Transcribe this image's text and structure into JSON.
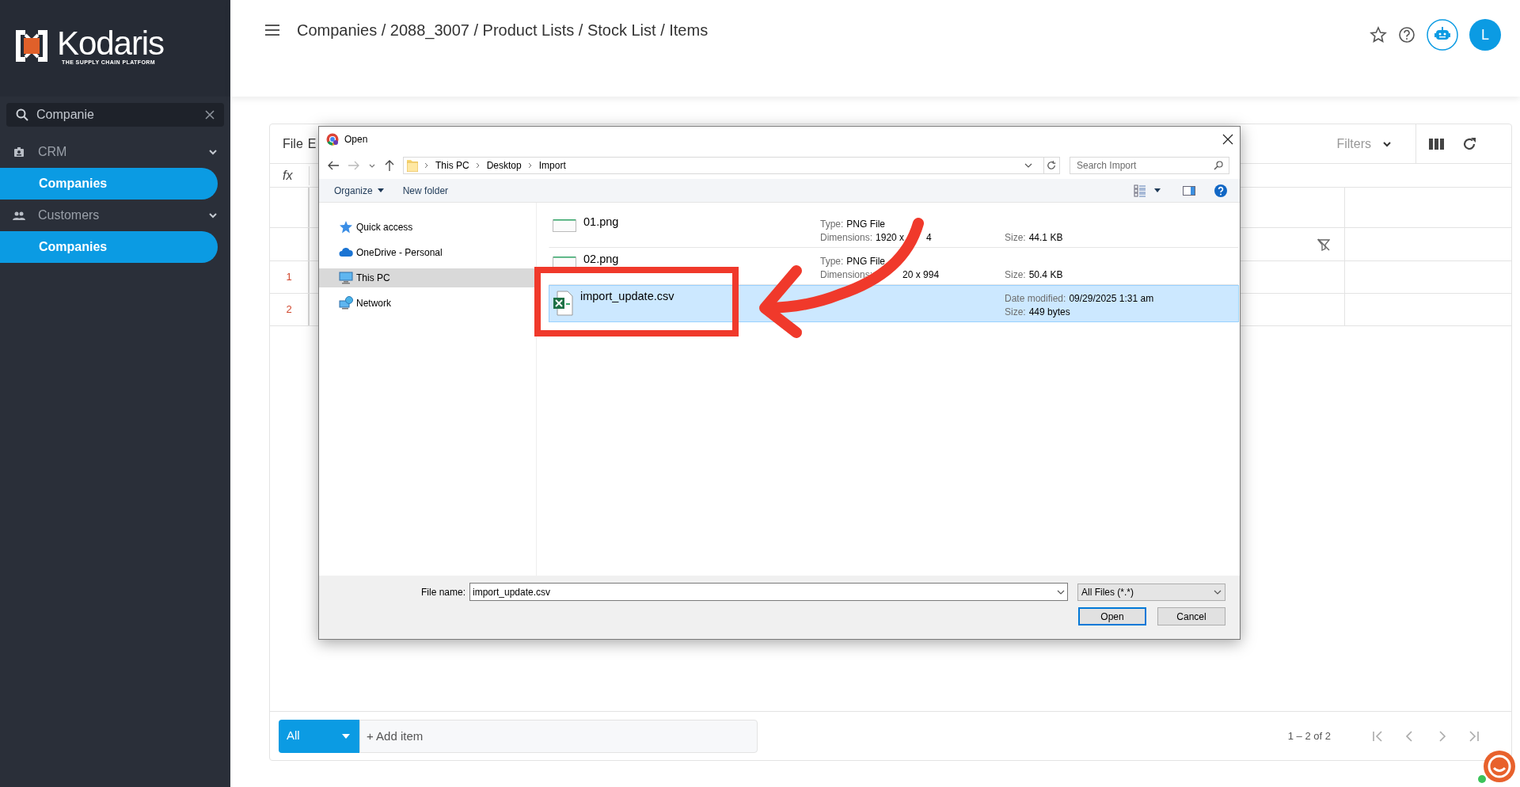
{
  "logo": {
    "name": "Kodaris",
    "tagline": "THE SUPPLY CHAIN PLATFORM"
  },
  "sidebar": {
    "search": {
      "value": "Companie"
    },
    "groups": [
      {
        "label": "CRM",
        "kind": "crm",
        "expanded": true,
        "items": [
          {
            "label": "Companies",
            "selected": true
          }
        ]
      },
      {
        "label": "Customers",
        "kind": "customers",
        "expanded": true,
        "items": [
          {
            "label": "Companies",
            "selected": true
          }
        ]
      }
    ]
  },
  "header": {
    "breadcrumb": "Companies / 2088_3007 / Product Lists / Stock List / Items",
    "avatar": "L"
  },
  "grid": {
    "menu": [
      "File",
      "E"
    ],
    "formula_label": "fx",
    "filters": "Filters",
    "row_numbers": [
      "1",
      "2"
    ],
    "footer": {
      "view": "All",
      "add_placeholder": "+ Add item",
      "range": "1 – 2 of 2"
    }
  },
  "dialog": {
    "title": "Open",
    "path": [
      "This PC",
      "Desktop",
      "Import"
    ],
    "search_placeholder": "Search Import",
    "toolbar": [
      "Organize",
      "New folder"
    ],
    "nav": [
      {
        "label": "Quick access",
        "kind": "star",
        "selected": false
      },
      {
        "label": "OneDrive - Personal",
        "kind": "cloud",
        "selected": false
      },
      {
        "label": "This PC",
        "kind": "pc",
        "selected": true
      },
      {
        "label": "Network",
        "kind": "network",
        "selected": false
      }
    ],
    "files": [
      {
        "name": "01.png",
        "kind": "image",
        "selected": false,
        "left": [
          {
            "label": "Type:",
            "value": "PNG File"
          },
          {
            "label": "Dimensions:",
            "value": "1920 x",
            "tail": "4"
          }
        ],
        "right": [
          {
            "label": "Size:",
            "value": "44.1 KB"
          }
        ]
      },
      {
        "name": "02.png",
        "kind": "image",
        "selected": false,
        "left": [
          {
            "label": "Type:",
            "value": "PNG File"
          },
          {
            "label": "Dimensions:",
            "value": "20 x 994",
            "gap": true
          }
        ],
        "right": [
          {
            "label": "Size:",
            "value": "50.4 KB"
          }
        ]
      },
      {
        "name": "import_update.csv",
        "kind": "spreadsheet",
        "selected": true,
        "right": [
          {
            "label": "Date modified:",
            "value": "09/29/2025 1:31 am"
          },
          {
            "label": "Size:",
            "value": "449 bytes"
          }
        ]
      }
    ],
    "file_name_label": "File name:",
    "file_name": "import_update.csv",
    "file_type": "All Files (*.*)",
    "buttons": [
      "Open",
      "Cancel"
    ]
  }
}
